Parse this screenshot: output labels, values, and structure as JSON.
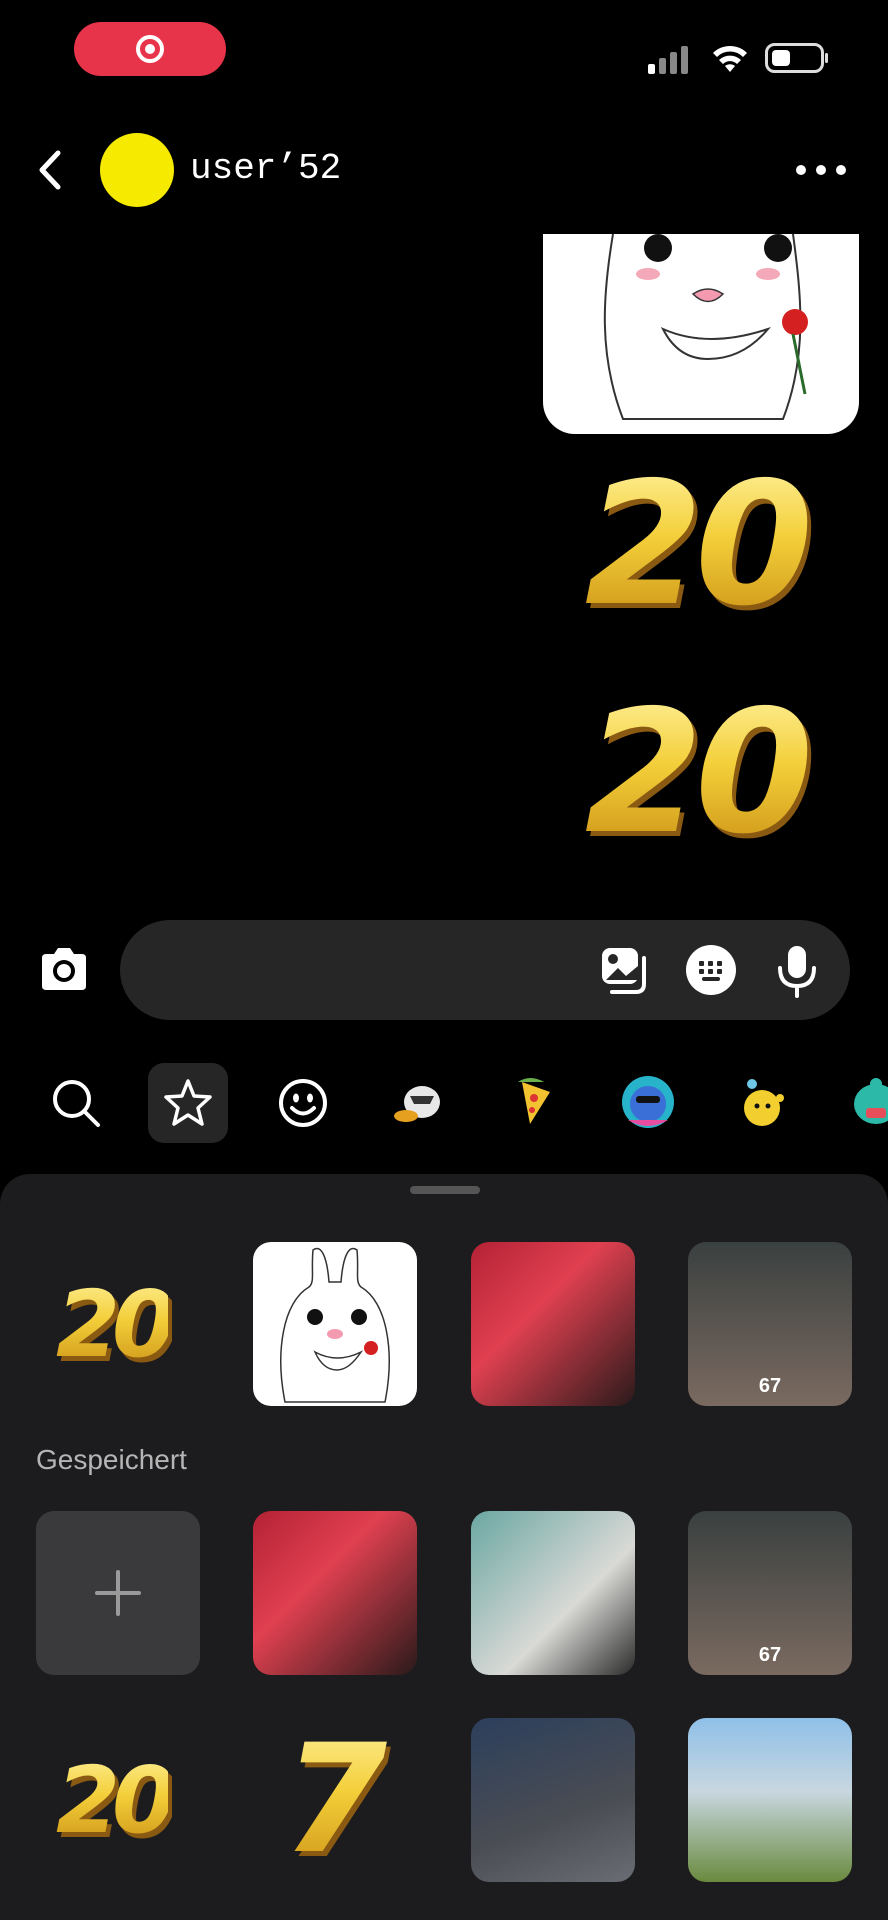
{
  "status_bar": {
    "recording_icon": "record-icon",
    "signal_icon": "cellular-signal-icon",
    "wifi_icon": "wifi-icon",
    "battery_icon": "battery-icon",
    "accent_color": "#e8344a"
  },
  "header": {
    "username": "user’52",
    "avatar_color": "#f5ea00",
    "back_icon": "chevron-left-icon",
    "more_icon": "more-horizontal-icon"
  },
  "messages": [
    {
      "type": "sticker",
      "name": "bunny-sticker"
    },
    {
      "type": "sticker",
      "text": "20"
    },
    {
      "type": "sticker",
      "text": "20"
    }
  ],
  "composer": {
    "camera_icon": "camera-icon",
    "gallery_icon": "gallery-icon",
    "sticker_icon": "sticker-keyboard-icon",
    "mic_icon": "microphone-icon"
  },
  "sticker_tabs": [
    "search-icon",
    "star-icon",
    "smiley-icon",
    "pack-raccoon",
    "pack-pizza",
    "pack-blob",
    "pack-chick",
    "pack-monster"
  ],
  "recent": [
    {
      "kind": "text",
      "text": "20"
    },
    {
      "kind": "bunny"
    },
    {
      "kind": "photo",
      "colors": [
        "#b42235",
        "#2a1a1a"
      ]
    },
    {
      "kind": "photo",
      "count": "67",
      "colors": [
        "#3a4040",
        "#7a6a60"
      ]
    }
  ],
  "saved_label": "Gespeichert",
  "saved": [
    {
      "kind": "add"
    },
    {
      "kind": "photo",
      "colors": [
        "#b42235",
        "#2a1a1a"
      ]
    },
    {
      "kind": "photo",
      "colors": [
        "#6aa7a2",
        "#d9d9d6"
      ]
    },
    {
      "kind": "photo",
      "count": "67",
      "colors": [
        "#3a4040",
        "#7a6a60"
      ]
    },
    {
      "kind": "text",
      "text": "20"
    },
    {
      "kind": "text",
      "text": "7"
    },
    {
      "kind": "photo",
      "colors": [
        "#2c3f5c",
        "#4a4d53"
      ]
    },
    {
      "kind": "photo",
      "colors": [
        "#8fc0e8",
        "#6a8a3e"
      ]
    }
  ]
}
